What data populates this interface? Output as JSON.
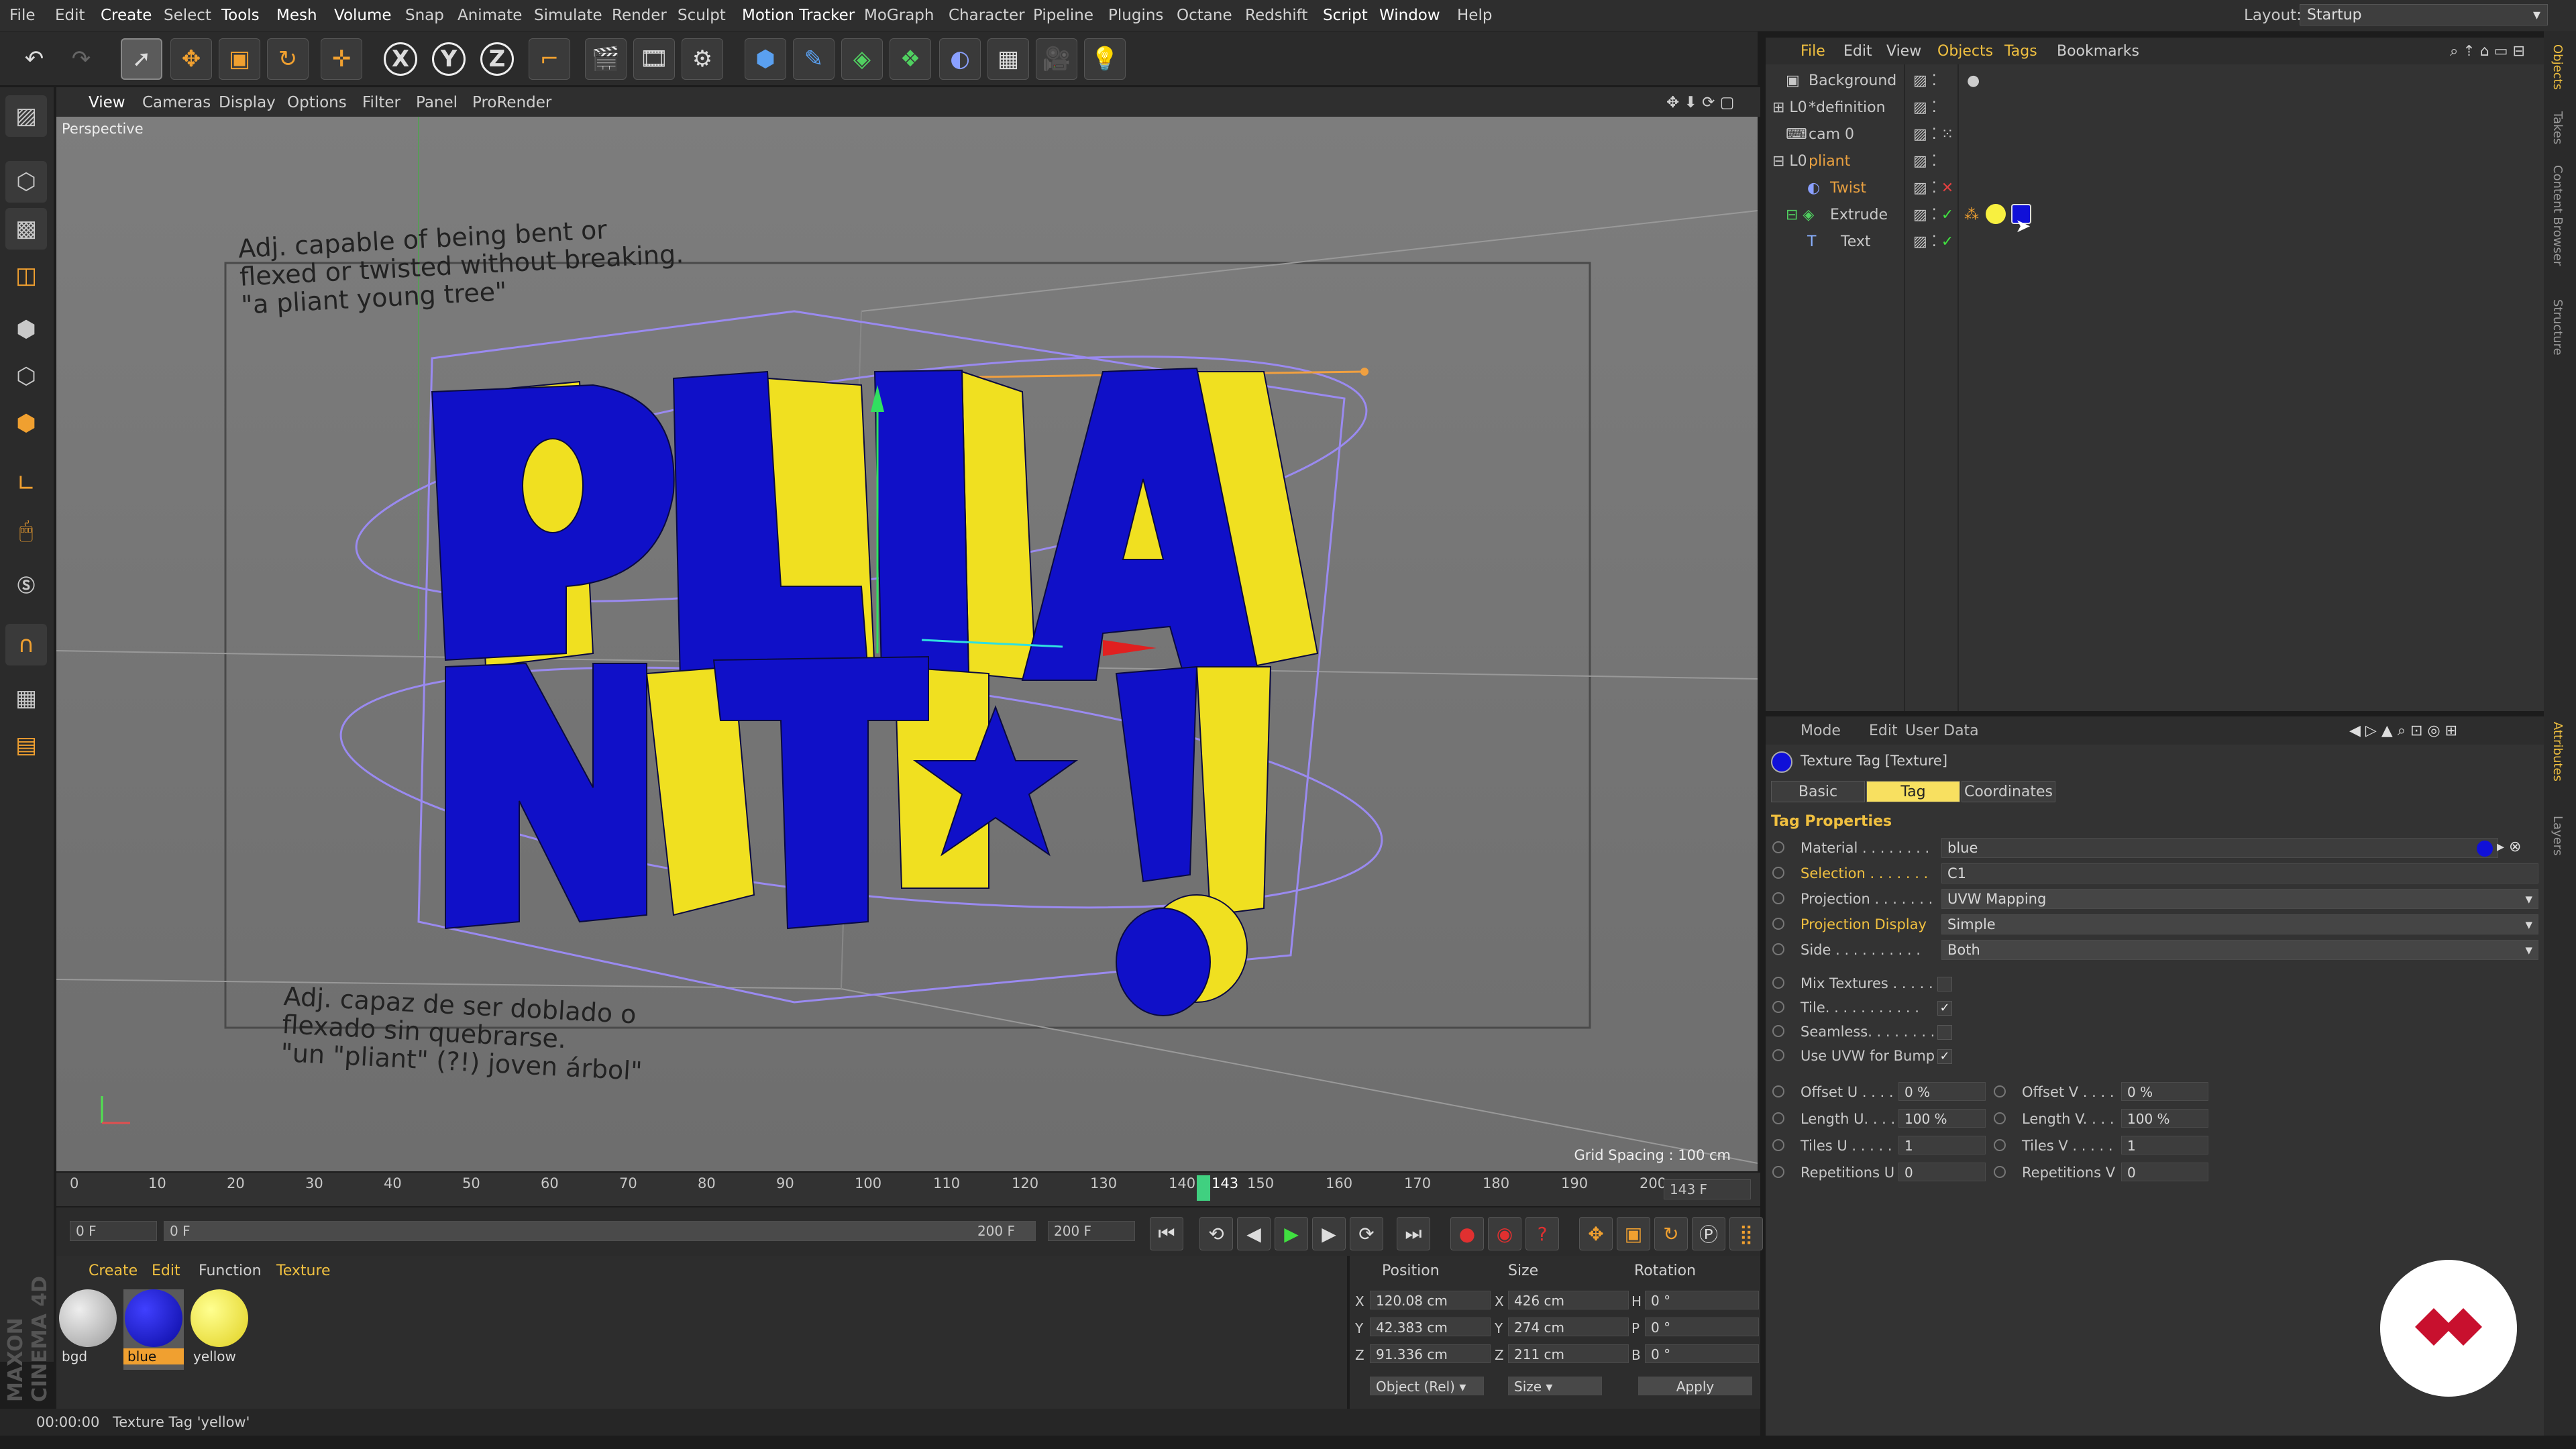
{
  "menubar": {
    "items": [
      "File",
      "Edit",
      "Create",
      "Select",
      "Tools",
      "Mesh",
      "Volume",
      "Snap",
      "Animate",
      "Simulate",
      "Render",
      "Sculpt",
      "Motion Tracker",
      "MoGraph",
      "Character",
      "Pipeline",
      "Plugins",
      "Octane",
      "Redshift",
      "Script",
      "Window",
      "Help"
    ],
    "layout_label": "Layout:",
    "layout_value": "Startup"
  },
  "toolbar": {
    "axis_x": "X",
    "axis_y": "Y",
    "axis_z": "Z"
  },
  "viewport": {
    "menu": [
      "View",
      "Cameras",
      "Display",
      "Options",
      "Filter",
      "Panel",
      "ProRender"
    ],
    "camera_label": "Perspective",
    "grid_spacing": "Grid Spacing : 100 cm",
    "text_en": [
      "Adj. capable of being bent or",
      "flexed or twisted without breaking.",
      "\"a pliant young tree\""
    ],
    "text_es": [
      "Adj. capaz de ser doblado o",
      "flexado sin quebrarse.",
      "\"un \"pliant\" (?!) joven árbol\""
    ],
    "title_lines": [
      "PLIA",
      "NT!"
    ],
    "colors": {
      "face": "#1010c8",
      "side": "#f0e020",
      "bg": "#767676"
    }
  },
  "timeline": {
    "ticks": [
      "0",
      "10",
      "20",
      "30",
      "40",
      "50",
      "60",
      "70",
      "80",
      "90",
      "100",
      "110",
      "120",
      "130",
      "140",
      "150",
      "160",
      "170",
      "180",
      "190",
      "200"
    ],
    "current_frame": "143",
    "current_frame_field": "143 F",
    "current_fraction": 0.715
  },
  "transport": {
    "start_field": "0 F",
    "range_start": "0 F",
    "range_end": "200 F",
    "end_field": "200 F"
  },
  "materials": {
    "menu": [
      "Create",
      "Edit",
      "Function",
      "Texture"
    ],
    "items": [
      {
        "name": "bgd",
        "color": "#c8c8c8"
      },
      {
        "name": "blue",
        "color": "#1010d8"
      },
      {
        "name": "yellow",
        "color": "#f8f040"
      }
    ]
  },
  "coords": {
    "headers": [
      "Position",
      "Size",
      "Rotation"
    ],
    "rows": [
      {
        "axis": "X",
        "pos": "120.08 cm",
        "saxis": "X",
        "size": "426 cm",
        "raxis": "H",
        "rot": "0 °"
      },
      {
        "axis": "Y",
        "pos": "42.383 cm",
        "saxis": "Y",
        "size": "274 cm",
        "raxis": "P",
        "rot": "0 °"
      },
      {
        "axis": "Z",
        "pos": "91.336 cm",
        "saxis": "Z",
        "size": "211 cm",
        "raxis": "B",
        "rot": "0 °"
      }
    ],
    "mode": "Object (Rel)",
    "size_mode": "Size",
    "apply": "Apply"
  },
  "status": {
    "time": "00:00:00",
    "message": "Texture Tag 'yellow'"
  },
  "objects": {
    "menu": [
      "File",
      "Edit",
      "View",
      "Objects",
      "Tags",
      "Bookmarks"
    ],
    "rows": [
      {
        "name": "Background",
        "color": "#c8c8c8"
      },
      {
        "name": "*definition",
        "color": "#c8c8c8"
      },
      {
        "name": "cam 0",
        "color": "#c8c8c8"
      },
      {
        "name": "pliant",
        "color": "#e8a040"
      },
      {
        "name": "Twist",
        "color": "#e8a040"
      },
      {
        "name": "Extrude",
        "color": "#c8c8c8"
      },
      {
        "name": "Text",
        "color": "#c8c8c8"
      }
    ]
  },
  "attributes": {
    "menu": [
      "Mode",
      "Edit",
      "User Data"
    ],
    "title": "Texture Tag [Texture]",
    "tabs": [
      "Basic",
      "Tag",
      "Coordinates"
    ],
    "active_tab": "Tag",
    "section": "Tag Properties",
    "props": [
      {
        "label": "Material . . . . . . . .",
        "value": "blue"
      },
      {
        "label": "Selection . . . . . . .",
        "value": "C1"
      },
      {
        "label": "Projection . . . . . . .",
        "value": "UVW Mapping"
      },
      {
        "label": "Projection Display",
        "value": "Simple"
      },
      {
        "label": "Side . . . . . . . . . .",
        "value": "Both"
      }
    ],
    "checks": [
      {
        "label": "Mix Textures . . . . .",
        "checked": ""
      },
      {
        "label": "Tile. . . . . . . . . . .",
        "checked": "✓"
      },
      {
        "label": "Seamless. . . . . . . .",
        "checked": ""
      },
      {
        "label": "Use UVW for Bump",
        "checked": "✓"
      }
    ],
    "nums": [
      {
        "l1": "Offset U . . . .",
        "v1": "0 %",
        "l2": "Offset V . . . .",
        "v2": "0 %"
      },
      {
        "l1": "Length U. . . .",
        "v1": "100 %",
        "l2": "Length V. . . .",
        "v2": "100 %"
      },
      {
        "l1": "Tiles U . . . . .",
        "v1": "1",
        "l2": "Tiles V . . . . .",
        "v2": "1"
      },
      {
        "l1": "Repetitions U",
        "v1": "0",
        "l2": "Repetitions V",
        "v2": "0"
      }
    ]
  },
  "side_tabs": [
    "Objects",
    "Takes",
    "Content Browser",
    "Structure",
    "Attributes",
    "Layers"
  ],
  "maxon": "MAXON CINEMA 4D"
}
